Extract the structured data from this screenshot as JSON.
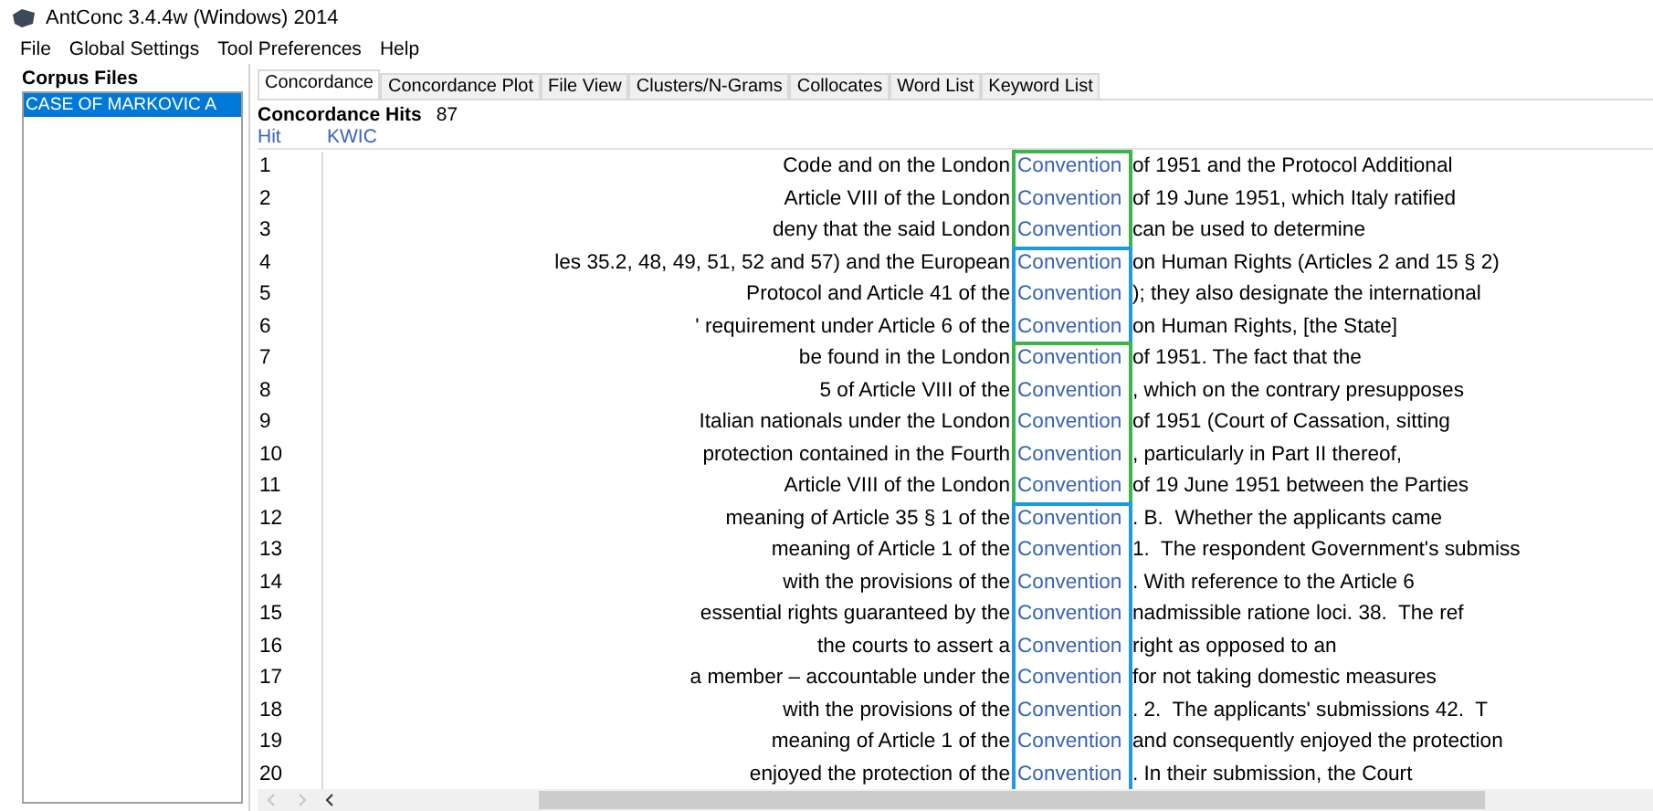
{
  "window": {
    "title": "AntConc 3.4.4w (Windows) 2014"
  },
  "menu": [
    "File",
    "Global Settings",
    "Tool Preferences",
    "Help"
  ],
  "sidebar": {
    "title": "Corpus Files",
    "items": [
      {
        "label": "CASE OF MARKOVIC A",
        "selected": true
      }
    ]
  },
  "tabs": [
    {
      "label": "Concordance",
      "selected": true
    },
    {
      "label": "Concordance Plot",
      "selected": false
    },
    {
      "label": "File View",
      "selected": false
    },
    {
      "label": "Clusters/N-Grams",
      "selected": false
    },
    {
      "label": "Collocates",
      "selected": false
    },
    {
      "label": "Word List",
      "selected": false
    },
    {
      "label": "Keyword List",
      "selected": false
    }
  ],
  "hits": {
    "label": "Concordance Hits",
    "count": "87"
  },
  "table": {
    "columns": [
      "Hit",
      "KWIC"
    ],
    "groups": [
      {
        "color": "#3cb44b",
        "rows": [
          {
            "hit": "1",
            "left": "Code and on the London",
            "keyword": "Convention",
            "right": "of 1951 and the Protocol Additional"
          },
          {
            "hit": "2",
            "left": "Article VIII of the London",
            "keyword": "Convention",
            "right": "of 19 June 1951, which Italy ratified"
          },
          {
            "hit": "3",
            "left": "deny that the said London",
            "keyword": "Convention",
            "right": "can be used to determine"
          }
        ]
      },
      {
        "color": "#1e9be0",
        "rows": [
          {
            "hit": "4",
            "left": "les 35.2, 48, 49, 51, 52 and 57) and the European",
            "keyword": "Convention",
            "right": "on Human Rights (Articles 2 and 15 § 2)"
          },
          {
            "hit": "5",
            "left": "Protocol and Article 41 of the",
            "keyword": "Convention",
            "right": "); they also designate the international"
          },
          {
            "hit": "6",
            "left": "' requirement under Article 6 of the",
            "keyword": "Convention",
            "right": "on Human Rights, [the State]"
          }
        ]
      },
      {
        "color": "#3cb44b",
        "rows": [
          {
            "hit": "7",
            "left": "be found in the London",
            "keyword": "Convention",
            "right": "of 1951. The fact that the"
          },
          {
            "hit": "8",
            "left": "5 of Article VIII of the",
            "keyword": "Convention",
            "right": ", which on the contrary presupposes"
          },
          {
            "hit": "9",
            "left": "Italian nationals under the London",
            "keyword": "Convention",
            "right": "of 1951 (Court of Cassation, sitting"
          },
          {
            "hit": "10",
            "left": "protection contained in the Fourth",
            "keyword": "Convention",
            "right": ", particularly in Part II thereof,"
          },
          {
            "hit": "11",
            "left": "Article VIII of the London",
            "keyword": "Convention",
            "right": "of 19 June 1951 between the Parties"
          }
        ]
      },
      {
        "color": "#1e9be0",
        "rows": [
          {
            "hit": "12",
            "left": "meaning of Article 35 § 1 of the",
            "keyword": "Convention",
            "right": ". B.  Whether the applicants came"
          },
          {
            "hit": "13",
            "left": "meaning of Article 1 of the",
            "keyword": "Convention",
            "right": "1.  The respondent Government's submiss"
          },
          {
            "hit": "14",
            "left": "with the provisions of the",
            "keyword": "Convention",
            "right": ". With reference to the Article 6"
          },
          {
            "hit": "15",
            "left": "essential rights guaranteed by the",
            "keyword": "Convention",
            "right": "nadmissible ratione loci. 38.  The ref"
          },
          {
            "hit": "16",
            "left": "the courts to assert a",
            "keyword": "Convention",
            "right": "right as opposed to an"
          },
          {
            "hit": "17",
            "left": "a member – accountable under the",
            "keyword": "Convention",
            "right": "for not taking domestic measures"
          },
          {
            "hit": "18",
            "left": "with the provisions of the",
            "keyword": "Convention",
            "right": ". 2.  The applicants' submissions 42.  T"
          },
          {
            "hit": "19",
            "left": "meaning of Article 1 of the",
            "keyword": "Convention",
            "right": "and consequently enjoyed the protection"
          },
          {
            "hit": "20",
            "left": "enjoyed the protection of the",
            "keyword": "Convention",
            "right": ". In their submission, the Court"
          }
        ]
      }
    ]
  }
}
